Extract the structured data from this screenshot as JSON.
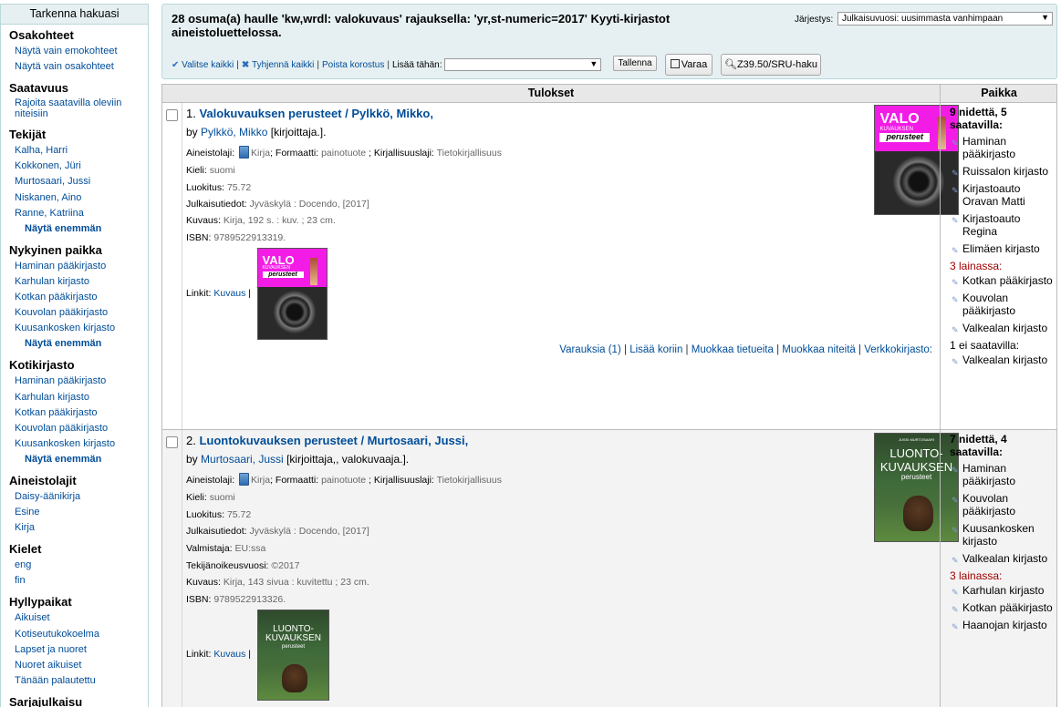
{
  "sidebar": {
    "heading": "Tarkenna hakuasi",
    "groups": [
      {
        "title": "Osakohteet",
        "items": [
          "Näytä vain emokohteet",
          "Näytä vain osakohteet"
        ]
      },
      {
        "title": "Saatavuus",
        "items": [
          "Rajoita saatavilla oleviin niteisiin"
        ]
      },
      {
        "title": "Tekijät",
        "items": [
          "Kalha, Harri",
          "Kokkonen, Jüri",
          "Murtosaari, Jussi",
          "Niskanen, Aino",
          "Ranne, Katriina"
        ],
        "more": "Näytä enemmän"
      },
      {
        "title": "Nykyinen paikka",
        "items": [
          "Haminan pääkirjasto",
          "Karhulan kirjasto",
          "Kotkan pääkirjasto",
          "Kouvolan pääkirjasto",
          "Kuusankosken kirjasto"
        ],
        "more": "Näytä enemmän"
      },
      {
        "title": "Kotikirjasto",
        "items": [
          "Haminan pääkirjasto",
          "Karhulan kirjasto",
          "Kotkan pääkirjasto",
          "Kouvolan pääkirjasto",
          "Kuusankosken kirjasto"
        ],
        "more": "Näytä enemmän"
      },
      {
        "title": "Aineistolajit",
        "items": [
          "Daisy-äänikirja",
          "Esine",
          "Kirja"
        ]
      },
      {
        "title": "Kielet",
        "items": [
          "eng",
          "fin"
        ]
      },
      {
        "title": "Hyllypaikat",
        "items": [
          "Aikuiset",
          "Kotiseutukokoelma",
          "Lapset ja nuoret",
          "Nuoret aikuiset",
          "Tänään palautettu"
        ]
      },
      {
        "title": "Sarjajulkaisu",
        "items": []
      }
    ]
  },
  "header": {
    "result_summary": "28 osuma(a) haulle 'kw,wrdl: valokuvaus' rajauksella: 'yr,st-numeric=2017' Kyyti-kirjastot aineistoluettelossa.",
    "sort_label": "Järjestys:",
    "sort_value": "Julkaisuvuosi: uusimmasta vanhimpaan",
    "select_all": "Valitse kaikki",
    "clear_all": "Tyhjennä kaikki",
    "remove_highlight": "Poista korostus",
    "add_to": "Lisää tähän:",
    "save": "Tallenna",
    "hold": "Varaa",
    "z3950": "Z39.50/SRU-haku"
  },
  "table": {
    "col_results": "Tulokset",
    "col_place": "Paikka"
  },
  "records": [
    {
      "num": "1.",
      "title": "Valokuvauksen perusteet / Pylkkö, Mikko,",
      "by": "by",
      "author": "Pylkkö, Mikko",
      "role": "[kirjoittaja.].",
      "material_label": "Aineistolaji:",
      "material": "Kirja",
      "format_label": "Formaatti:",
      "format": "painotuote",
      "genre_label": "Kirjallisuuslaji:",
      "genre": "Tietokirjallisuus",
      "fields": [
        {
          "label": "Kieli:",
          "value": "suomi"
        },
        {
          "label": "Luokitus:",
          "value": "75.72"
        },
        {
          "label": "Julkaisutiedot:",
          "value": "Jyväskylä : Docendo, [2017]"
        },
        {
          "label": "Kuvaus:",
          "value": "Kirja, 192 s. : kuv. ; 23 cm."
        },
        {
          "label": "ISBN:",
          "value": "9789522913319."
        }
      ],
      "links_label": "Linkit:",
      "links_value": "Kuvaus",
      "actions": [
        "Varauksia (1)",
        "Lisää koriin",
        "Muokkaa tietueita",
        "Muokkaa niteitä",
        "Verkkokirjasto:"
      ],
      "cover": {
        "line1": "VALO",
        "line2": "KUVAUKSEN",
        "line3": "perusteet"
      },
      "availability": {
        "available": "9 nidettä, 5 saatavilla:",
        "available_libs": [
          "Haminan pääkirjasto",
          "Ruissalon kirjasto",
          "Kirjastoauto Oravan Matti",
          "Kirjastoauto Regina",
          "Elimäen kirjasto"
        ],
        "on_loan": "3 lainassa:",
        "loan_libs": [
          "Kotkan pääkirjasto",
          "Kouvolan pääkirjasto",
          "Valkealan kirjasto"
        ],
        "not_available": "1 ei saatavilla:",
        "na_libs": [
          "Valkealan kirjasto"
        ]
      }
    },
    {
      "num": "2.",
      "title": "Luontokuvauksen perusteet / Murtosaari, Jussi,",
      "by": "by",
      "author": "Murtosaari, Jussi",
      "role": "[kirjoittaja,, valokuvaaja.].",
      "material_label": "Aineistolaji:",
      "material": "Kirja",
      "format_label": "Formaatti:",
      "format": "painotuote",
      "genre_label": "Kirjallisuuslaji:",
      "genre": "Tietokirjallisuus",
      "fields": [
        {
          "label": "Kieli:",
          "value": "suomi"
        },
        {
          "label": "Luokitus:",
          "value": "75.72"
        },
        {
          "label": "Julkaisutiedot:",
          "value": "Jyväskylä : Docendo, [2017]"
        },
        {
          "label": "Valmistaja:",
          "value": "EU:ssa"
        },
        {
          "label": "Tekijänoikeusvuosi:",
          "value": "©2017"
        },
        {
          "label": "Kuvaus:",
          "value": "Kirja, 143 sivua : kuvitettu ; 23 cm."
        },
        {
          "label": "ISBN:",
          "value": "9789522913326."
        }
      ],
      "links_label": "Linkit:",
      "links_value": "Kuvaus",
      "cover": {
        "line1": "LUONTO-",
        "line2": "KUVAUKSEN",
        "line3": "perusteet",
        "author": "JUSSI MURTOSAARI"
      },
      "availability": {
        "available": "7 nidettä, 4 saatavilla:",
        "available_libs": [
          "Haminan pääkirjasto",
          "Kouvolan pääkirjasto",
          "Kuusankosken kirjasto",
          "Valkealan kirjasto"
        ],
        "on_loan": "3 lainassa:",
        "loan_libs": [
          "Karhulan kirjasto",
          "Kotkan pääkirjasto",
          "Haanojan kirjasto"
        ]
      }
    }
  ]
}
